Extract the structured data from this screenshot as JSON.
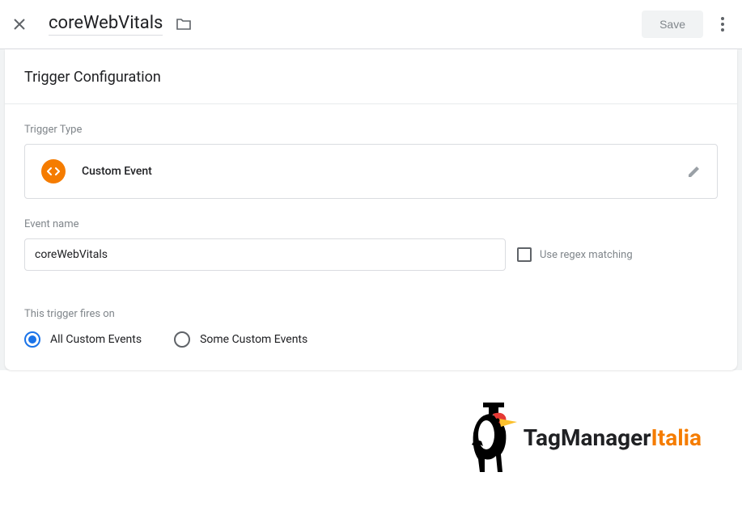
{
  "header": {
    "title": "coreWebVitals",
    "save_label": "Save"
  },
  "config": {
    "section_title": "Trigger Configuration",
    "trigger_type_label": "Trigger Type",
    "trigger_type_value": "Custom Event",
    "event_name_label": "Event name",
    "event_name_value": "coreWebVitals",
    "regex_label": "Use regex matching",
    "fires_on_label": "This trigger fires on",
    "radio_all": "All Custom Events",
    "radio_some": "Some Custom Events"
  },
  "branding": {
    "text1": "TagManager",
    "text2": "Italia"
  }
}
